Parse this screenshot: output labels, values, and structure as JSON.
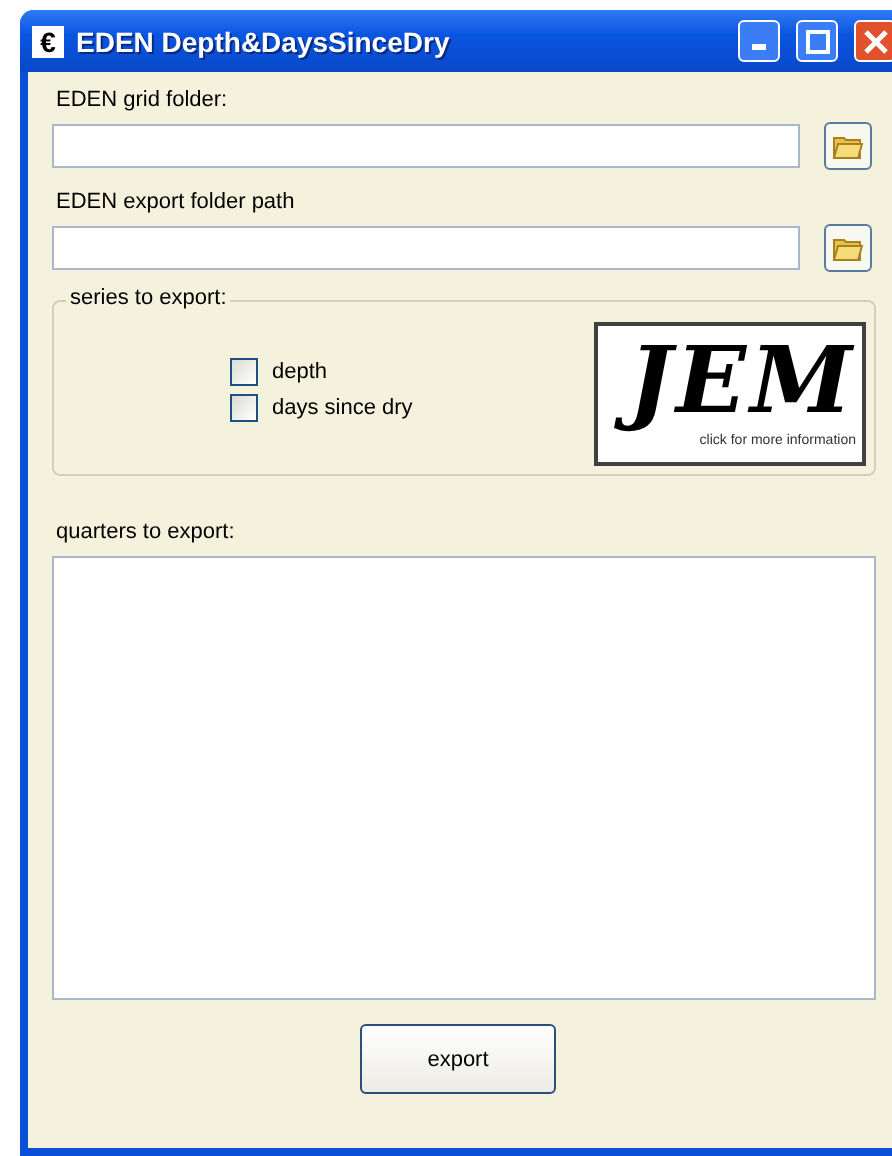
{
  "window": {
    "title": "EDEN Depth&DaysSinceDry",
    "icon_letter": "€"
  },
  "grid_folder": {
    "label": "EDEN grid folder:"
  },
  "export_folder": {
    "label": "EDEN export folder path"
  },
  "series": {
    "legend": "series to export:",
    "options": [
      {
        "label": "depth",
        "checked": false
      },
      {
        "label": "days since dry",
        "checked": false
      }
    ],
    "logo": {
      "mark": "JEM",
      "caption": "click for more information"
    }
  },
  "quarters": {
    "label": "quarters to export:"
  },
  "export_button": "export"
}
